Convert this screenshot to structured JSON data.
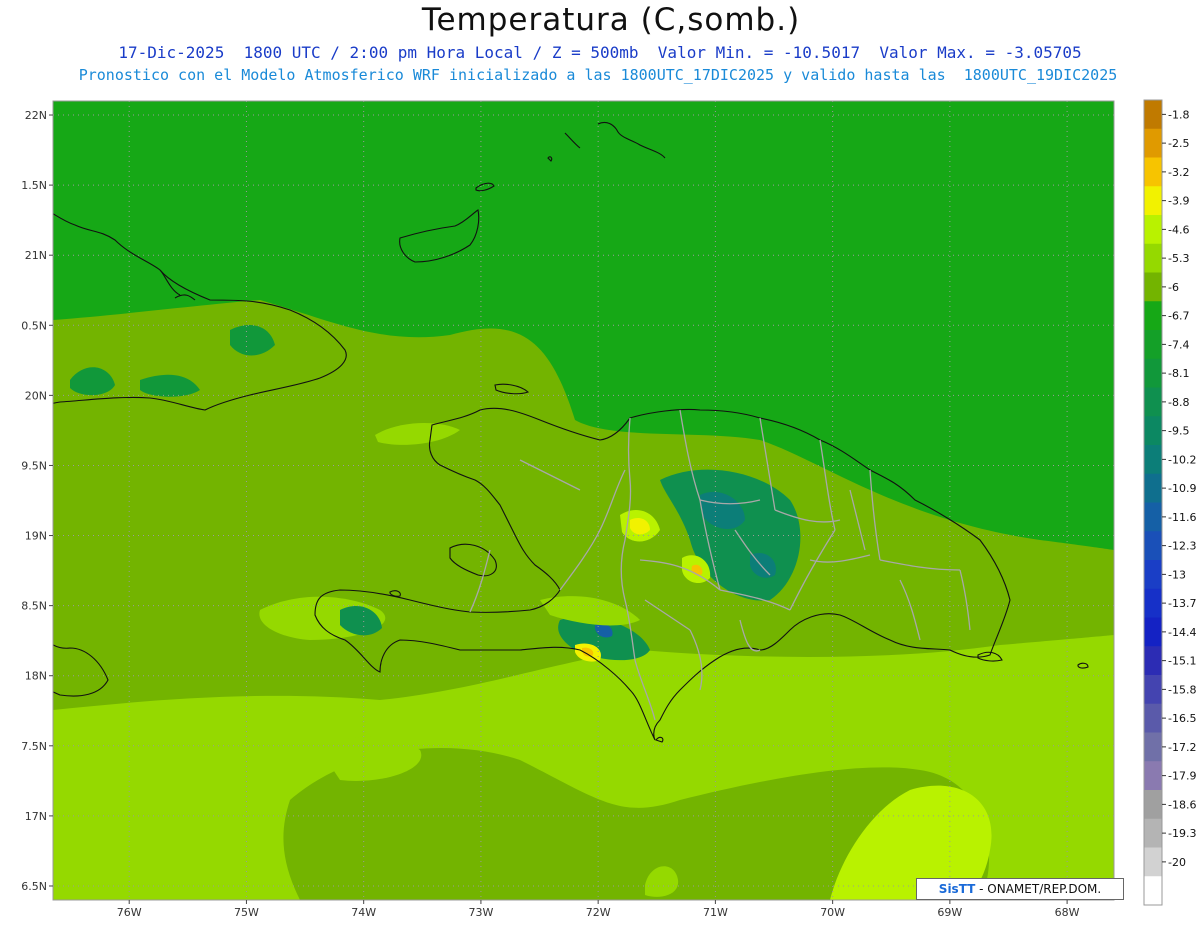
{
  "header": {
    "title": "Temperatura (C,somb.)",
    "subtitle1": "17-Dic-2025  1800 UTC / 2:00 pm Hora Local / Z = 500mb  Valor Min. = -10.5017  Valor Max. = -3.05705",
    "subtitle2": "Pronostico con el Modelo Atmosferico WRF inicializado a las 1800UTC_17DIC2025 y valido hasta las  1800UTC_19DIC2025"
  },
  "axes": {
    "lat_labels": [
      "22N",
      "1.5N",
      "21N",
      "0.5N",
      "20N",
      "9.5N",
      "19N",
      "8.5N",
      "18N",
      "7.5N",
      "17N",
      "6.5N"
    ],
    "lon_labels": [
      "76W",
      "75W",
      "74W",
      "73W",
      "72W",
      "71W",
      "70W",
      "69W",
      "68W"
    ],
    "lat_range": [
      16.4,
      22.1
    ],
    "lon_range": [
      -76.65,
      -67.6
    ]
  },
  "colorbar": {
    "labels": [
      "-1.8",
      "-2.5",
      "-3.2",
      "-3.9",
      "-4.6",
      "-5.3",
      "-6",
      "-6.7",
      "-7.4",
      "-8.1",
      "-8.8",
      "-9.5",
      "-10.2",
      "-10.9",
      "-11.6",
      "-12.3",
      "-13",
      "-13.7",
      "-14.4",
      "-15.1",
      "-15.8",
      "-16.5",
      "-17.2",
      "-17.9",
      "-18.6",
      "-19.3",
      "-20"
    ],
    "colors": [
      "#c07a00",
      "#e09a00",
      "#f7c400",
      "#f2f200",
      "#b9f200",
      "#95d900",
      "#73b400",
      "#16a816",
      "#14a028",
      "#11983a",
      "#0f904f",
      "#0c8862",
      "#0c7e78",
      "#0f6f8e",
      "#1560a6",
      "#1a50b8",
      "#1a3ec6",
      "#1630c8",
      "#1422c4",
      "#2c2cb4",
      "#4444b0",
      "#5a5aaa",
      "#7070a8",
      "#8a7ab0",
      "#a0a0a0",
      "#b4b4b4",
      "#d2d2d2",
      "#ffffff"
    ]
  },
  "credit": {
    "logo": "SisTT",
    "text": " - ONAMET/REP.DOM."
  }
}
